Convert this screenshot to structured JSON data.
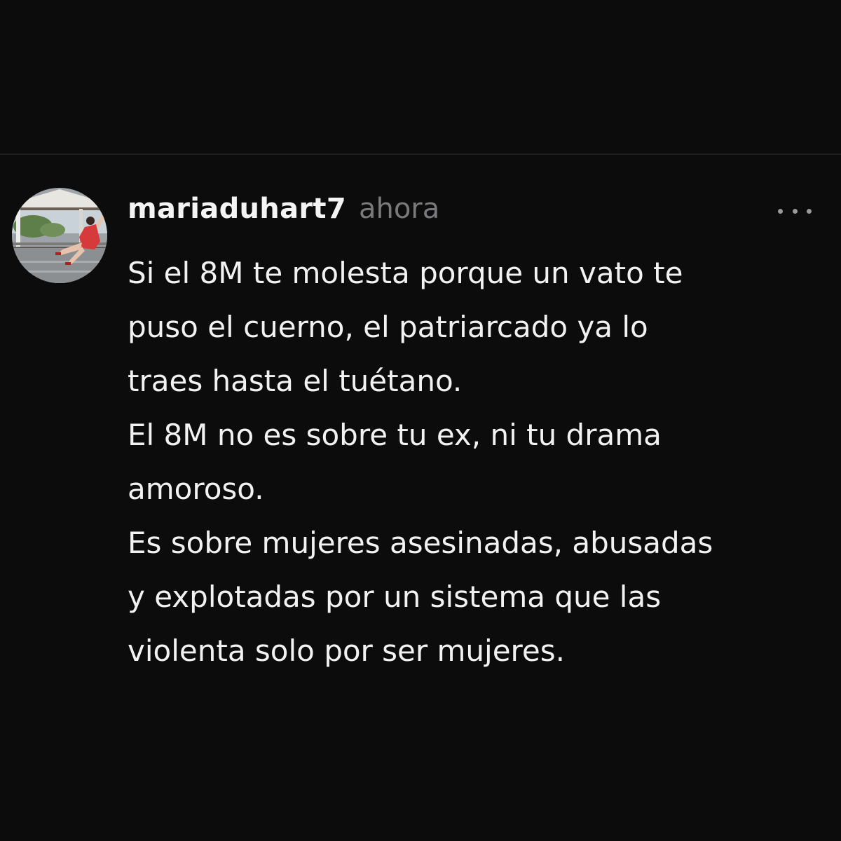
{
  "post": {
    "username": "mariaduhart7",
    "time": "ahora",
    "more_icon": "more-horizontal-icon",
    "lines": [
      "Si el 8M te molesta porque un vato te",
      "puso el cuerno, el patriarcado ya lo",
      "traes hasta el tuétano.",
      "El 8M no es sobre tu ex, ni tu drama",
      "amoroso.",
      "Es sobre mujeres asesinadas, abusadas",
      "y explotadas por un sistema que las",
      "violenta solo por ser mujeres."
    ]
  },
  "colors": {
    "background": "#0c0c0d",
    "text": "#f2f2f2",
    "muted": "#7a7a7c",
    "divider": "#1f1f21"
  }
}
